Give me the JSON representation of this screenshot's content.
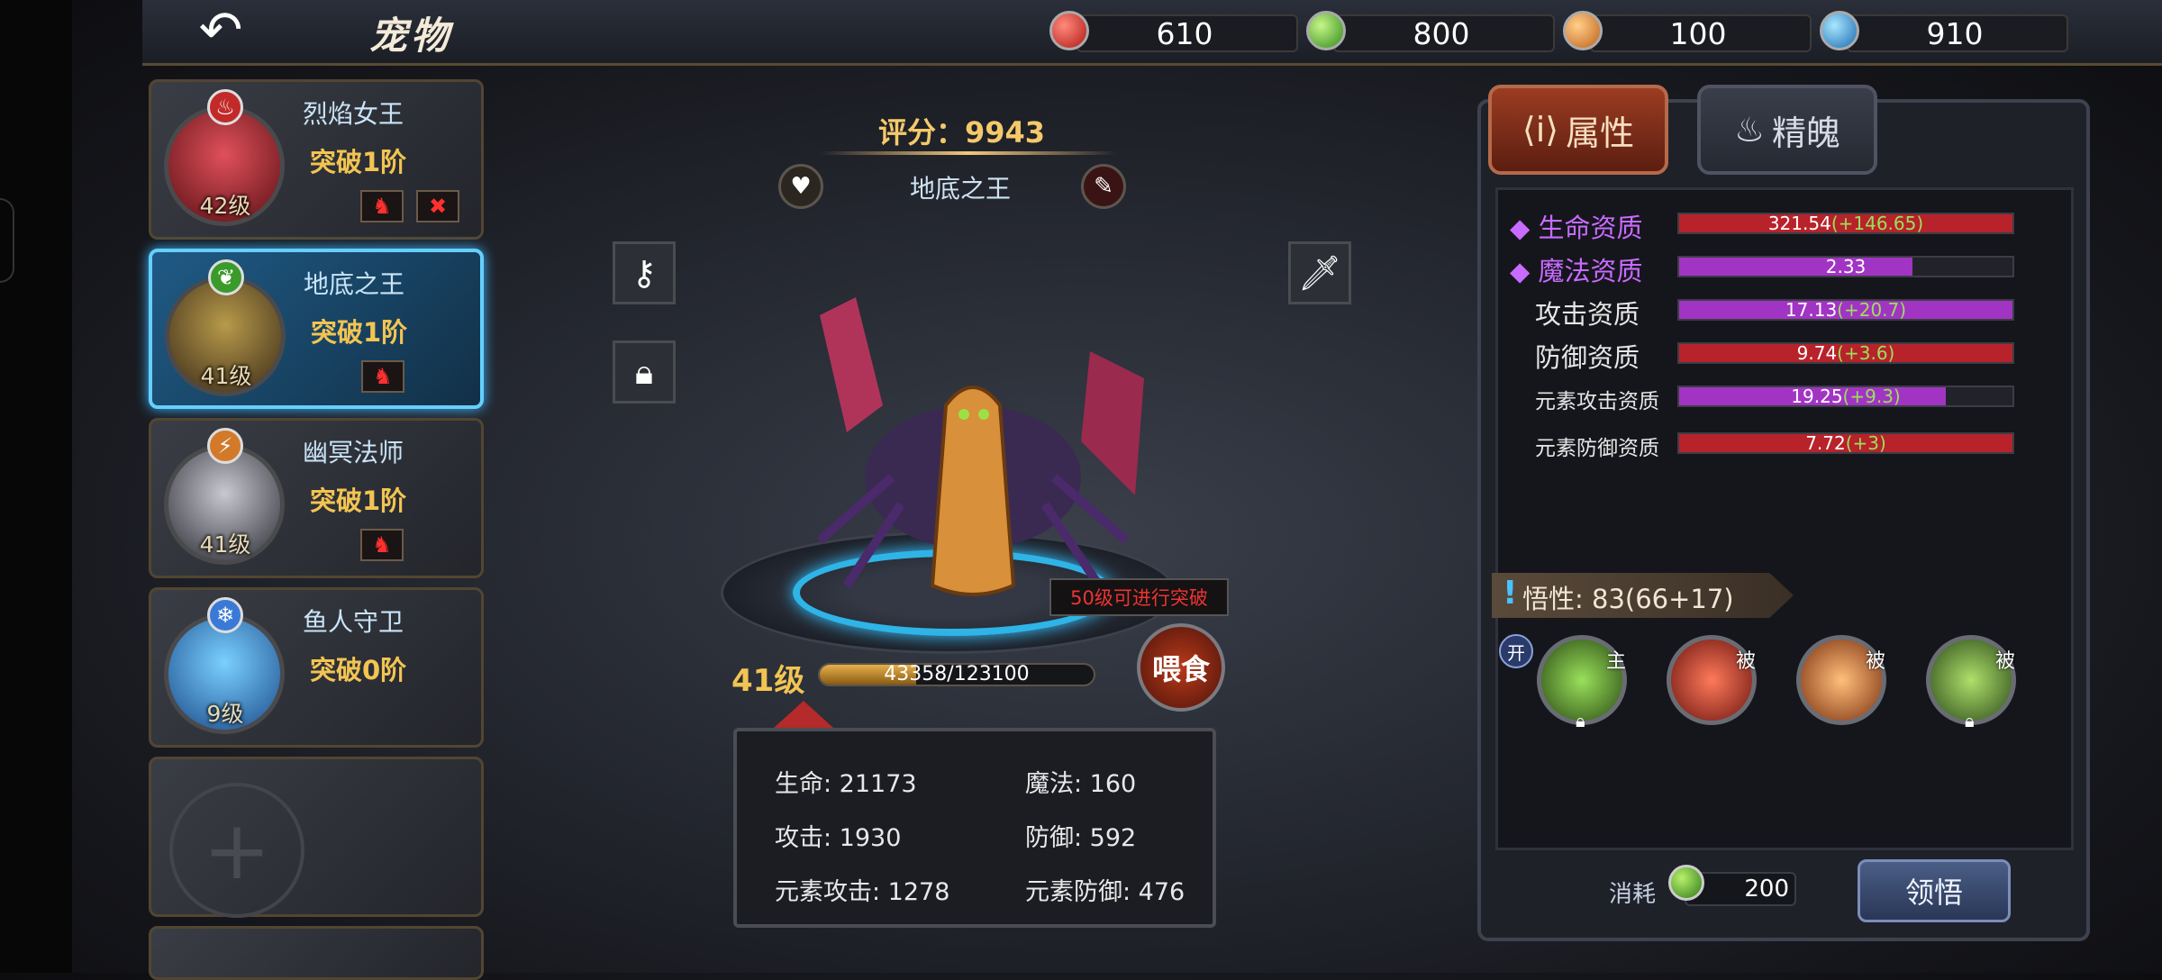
{
  "header": {
    "title": "宠物",
    "back_icon": "back-arrow-icon"
  },
  "resources": [
    {
      "name": "red-gem-icon",
      "value": "610",
      "color": "#d8332b"
    },
    {
      "name": "green-gem-icon",
      "value": "800",
      "color": "#4fc02c"
    },
    {
      "name": "orange-lightning-icon",
      "value": "100",
      "color": "#e88a2a"
    },
    {
      "name": "blue-snowflake-icon",
      "value": "910",
      "color": "#3aa6e6"
    }
  ],
  "pets": [
    {
      "name": "烈焰女王",
      "break": "突破1阶",
      "level": "42级",
      "element": "fire-icon",
      "color": "#c22a2a"
    },
    {
      "name": "地底之王",
      "break": "突破1阶",
      "level": "41级",
      "element": "leaf-icon",
      "color": "#5a6a3a"
    },
    {
      "name": "幽冥法师",
      "break": "突破1阶",
      "level": "41级",
      "element": "lightning-icon",
      "color": "#6a5a7a"
    },
    {
      "name": "鱼人守卫",
      "break": "突破0阶",
      "level": "9级",
      "element": "snowflake-icon",
      "color": "#3a7ad6"
    }
  ],
  "center": {
    "score": "评分：9943",
    "pet_name": "地底之王",
    "level": "41级",
    "exp_text": "43358/123100",
    "exp_fraction": 0.352,
    "hint": "50级可进行突破",
    "feed_label": "喂食",
    "stats": {
      "hp": "生命: 21173",
      "mp": "魔法: 160",
      "atk": "攻击: 1930",
      "def": "防御: 592",
      "eatk": "元素攻击: 1278",
      "edef": "元素防御: 476"
    }
  },
  "tabs": {
    "attributes": "属性",
    "essence": "精魄"
  },
  "attributes": [
    {
      "label": "生命资质",
      "value": "321.54",
      "bonus": "(+146.65)",
      "fill": 1.0,
      "color": "#b8222a",
      "highlight": true
    },
    {
      "label": "魔法资质",
      "value": "2.33",
      "bonus": "",
      "fill": 0.7,
      "color": "#a234c4",
      "highlight": true
    },
    {
      "label": "攻击资质",
      "value": "17.13",
      "bonus": "(+20.7)",
      "fill": 1.0,
      "color": "#a234c4",
      "highlight": false
    },
    {
      "label": "防御资质",
      "value": "9.74",
      "bonus": "(+3.6)",
      "fill": 1.0,
      "color": "#b8222a",
      "highlight": false
    },
    {
      "label": "元素攻击资质",
      "value": "19.25",
      "bonus": "(+9.3)",
      "fill": 0.8,
      "color": "#a234c4",
      "highlight": false
    },
    {
      "label": "元素防御资质",
      "value": "7.72",
      "bonus": "(+3)",
      "fill": 1.0,
      "color": "#b8222a",
      "highlight": false
    }
  ],
  "insight": {
    "text": "悟性: 83(66+17)",
    "toggle": "开"
  },
  "skills": [
    {
      "type": "主",
      "icon": "skill-green-beast-icon",
      "color": "#4a8a2a",
      "locked": true
    },
    {
      "type": "被",
      "icon": "skill-red-claw-icon",
      "color": "#b8342a",
      "locked": false
    },
    {
      "type": "被",
      "icon": "skill-fire-slash-icon",
      "color": "#d2702a",
      "locked": false
    },
    {
      "type": "被",
      "icon": "skill-green-warrior-icon",
      "color": "#5a8a3a",
      "locked": true
    }
  ],
  "footer": {
    "cost_label": "消耗",
    "cost_value": "200",
    "learn_button": "领悟"
  }
}
